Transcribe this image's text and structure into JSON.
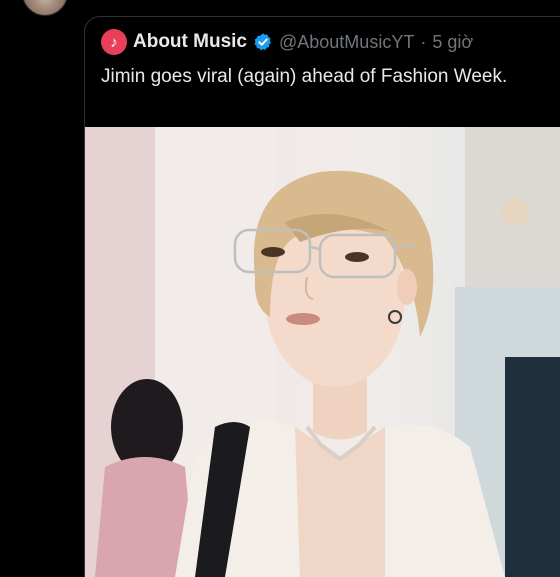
{
  "tweet": {
    "display_name": "About Music",
    "handle": "@AboutMusicYT",
    "separator": "·",
    "time": "5 giờ",
    "text": "Jimin goes viral (again) ahead of Fashion Week."
  },
  "icons": {
    "source_avatar": "music-note-icon",
    "verified": "verified-badge-icon"
  },
  "colors": {
    "background": "#000000",
    "text_primary": "#e7e9ea",
    "text_secondary": "#71767b",
    "verified_blue": "#1d9bf0",
    "avatar_pink": "#e8405a"
  }
}
